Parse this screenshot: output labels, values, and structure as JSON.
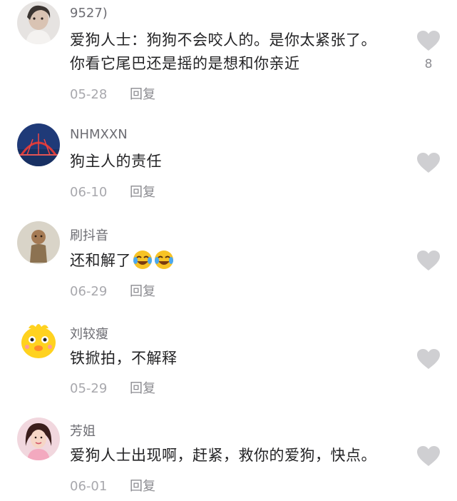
{
  "colors": {
    "heart": "#cfcfd2",
    "username": "#6d6d73",
    "meta": "#a8a8ad",
    "text": "#232325"
  },
  "comments": [
    {
      "username": "9527)",
      "text": "爱狗人士：狗狗不会咬人的。是你太紧张了。你看它尾巴还是摇的是想和你亲近",
      "date": "05-28",
      "reply_label": "回复",
      "like_count": "8",
      "avatar_icon": "avatar-portrait-icon"
    },
    {
      "username": "NHMXXN",
      "text": "狗主人的责任",
      "date": "06-10",
      "reply_label": "回复",
      "avatar_icon": "avatar-bridge-icon"
    },
    {
      "username": "刷抖音",
      "text": "还和解了",
      "date": "06-29",
      "reply_label": "回复",
      "avatar_icon": "avatar-figure-icon",
      "emoji": "laughing-crying-emoji"
    },
    {
      "username": "刘较瘦",
      "text": "铁掀拍，不解释",
      "date": "05-29",
      "reply_label": "回复",
      "avatar_icon": "avatar-cartoon-chick-icon"
    },
    {
      "username": "芳姐",
      "text": "爱狗人士出现啊，赶紧，救你的爱狗，快点。",
      "date": "06-01",
      "reply_label": "回复",
      "avatar_icon": "avatar-woman-portrait-icon"
    }
  ]
}
